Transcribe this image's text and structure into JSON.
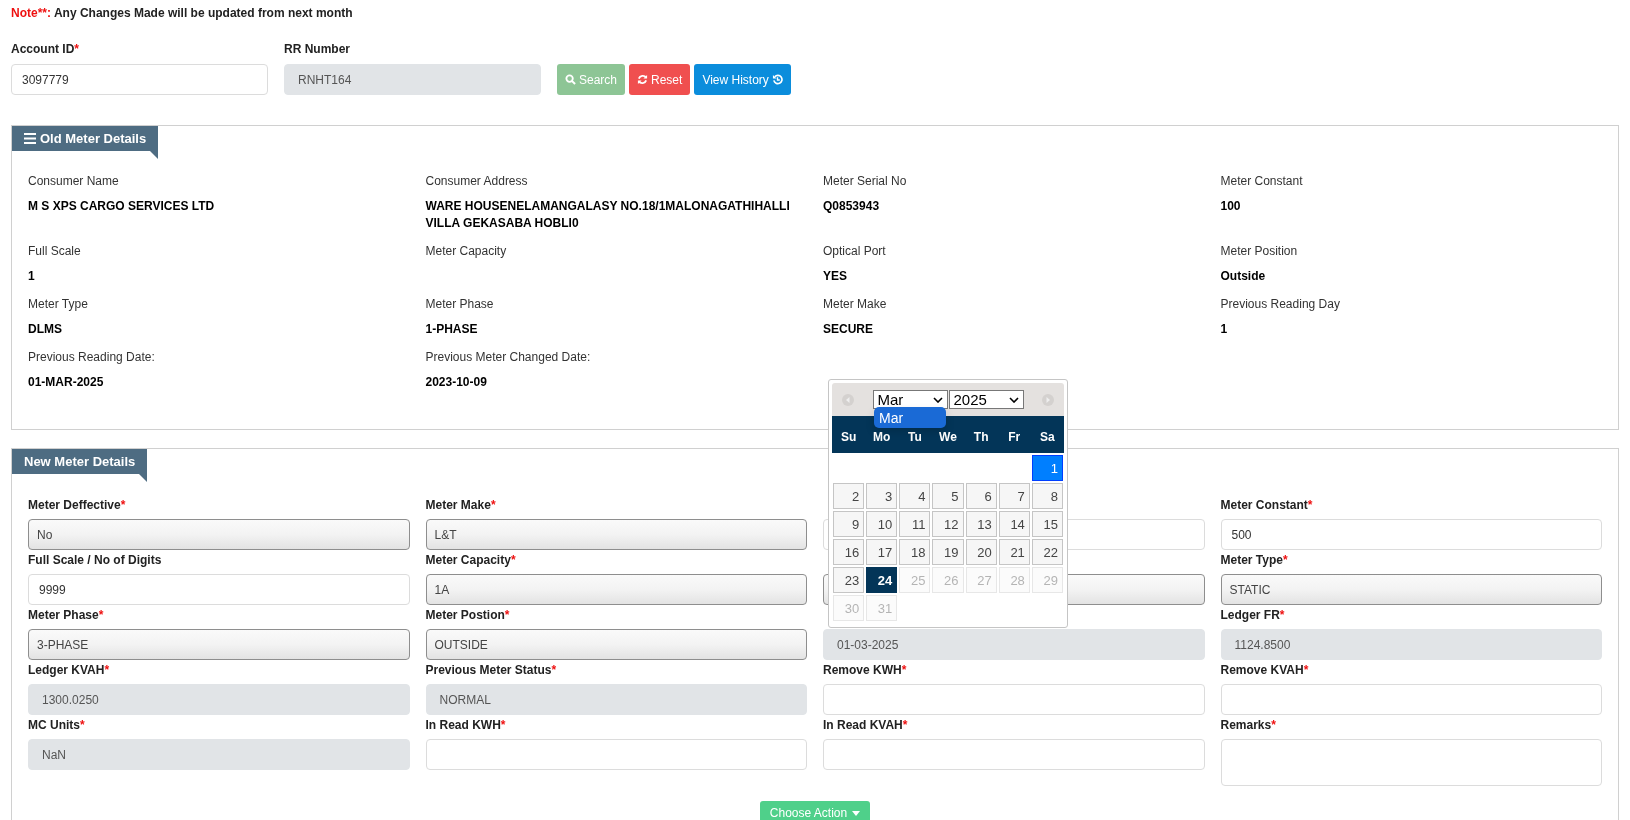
{
  "note": {
    "prefix": "Note**:",
    "text": "Any Changes Made will be updated from next month"
  },
  "search_form": {
    "fields": [
      {
        "label": "Account ID",
        "required_mark": "*",
        "value": "3097779",
        "readonly": false
      },
      {
        "label": "RR Number",
        "value": "RNHT164",
        "readonly": true
      }
    ],
    "buttons": [
      {
        "label": "Search",
        "kind": "search"
      },
      {
        "label": "Reset",
        "kind": "reset"
      },
      {
        "label": "View History",
        "kind": "history"
      }
    ]
  },
  "old_meter": {
    "title": "Old Meter Details",
    "items": [
      {
        "label": "Consumer Name",
        "value": "M S XPS CARGO SERVICES LTD"
      },
      {
        "label": "Consumer Address",
        "value": "WARE HOUSENELAMANGALASY NO.18/1MALONAGATHIHALLI VILLA GEKASABA HOBLI0"
      },
      {
        "label": "Meter Serial No",
        "value": "Q0853943"
      },
      {
        "label": "Meter Constant",
        "value": "100"
      },
      {
        "label": "Full Scale",
        "value": "1"
      },
      {
        "label": "Meter Capacity"
      },
      {
        "label": "Optical Port",
        "value": "YES"
      },
      {
        "label": "Meter Position",
        "value": "Outside"
      },
      {
        "label": "Meter Type",
        "value": "DLMS"
      },
      {
        "label": "Meter Phase",
        "value": "1-PHASE"
      },
      {
        "label": "Meter Make",
        "value": "SECURE"
      },
      {
        "label": "Previous Reading Day",
        "value": "1"
      },
      {
        "label": "Previous Reading Date:",
        "value": "01-MAR-2025"
      },
      {
        "label": "Previous Meter Changed Date:",
        "value": "2023-10-09"
      }
    ]
  },
  "new_meter": {
    "title": "New Meter Details",
    "fields": [
      {
        "label": "Meter Deffective",
        "required_mark": "*",
        "kind": "select",
        "value": "No"
      },
      {
        "label": "Meter Make",
        "required_mark": "*",
        "kind": "select",
        "value": "L&T"
      },
      {
        "kind": "input"
      },
      {
        "label": "Meter Constant",
        "required_mark": "*",
        "kind": "input",
        "value": "500"
      },
      {
        "label": "Full Scale / No of Digits",
        "kind": "input",
        "value": "9999"
      },
      {
        "label": "Meter Capacity",
        "required_mark": "*",
        "kind": "select",
        "value": "1A"
      },
      {
        "kind": "select"
      },
      {
        "label": "Meter Type",
        "required_mark": "*",
        "kind": "select",
        "value": "STATIC"
      },
      {
        "label": "Meter Phase",
        "required_mark": "*",
        "kind": "select",
        "value": "3-PHASE"
      },
      {
        "label": "Meter Postion",
        "required_mark": "*",
        "kind": "select",
        "value": "OUTSIDE"
      },
      {
        "kind": "readonly",
        "value": "01-03-2025"
      },
      {
        "label": "Ledger FR",
        "required_mark": "*",
        "kind": "readonly",
        "value": "1124.8500"
      },
      {
        "label": "Ledger KVAH",
        "required_mark": "*",
        "kind": "readonly",
        "value": "1300.0250"
      },
      {
        "label": "Previous Meter Status",
        "required_mark": "*",
        "kind": "readonly",
        "value": "NORMAL"
      },
      {
        "label": "Remove KWH",
        "required_mark": "*",
        "kind": "input"
      },
      {
        "label": "Remove KVAH",
        "required_mark": "*",
        "kind": "input"
      },
      {
        "label": "MC Units",
        "required_mark": "*",
        "kind": "readonly",
        "value": "NaN"
      },
      {
        "label": "In Read KWH",
        "required_mark": "*",
        "kind": "input"
      },
      {
        "label": "In Read KVAH",
        "required_mark": "*",
        "kind": "input"
      },
      {
        "label": "Remarks",
        "required_mark": "*",
        "kind": "textarea"
      }
    ],
    "action_button": "Choose Action"
  },
  "datepicker": {
    "month": "Mar",
    "year": "2025",
    "month_options": [
      {
        "label": "Mar",
        "selected": true
      }
    ],
    "weekdays": [
      "Su",
      "Mo",
      "Tu",
      "We",
      "Th",
      "Fr",
      "Sa"
    ],
    "weeks": [
      [
        {
          "day": "1",
          "selected": true,
          "today": false,
          "disabled": false
        }
      ],
      [
        {
          "day": "2",
          "selected": false,
          "today": false,
          "disabled": false
        },
        {
          "day": "3",
          "selected": false,
          "today": false,
          "disabled": false
        },
        {
          "day": "4",
          "selected": false,
          "today": false,
          "disabled": false
        },
        {
          "day": "5",
          "selected": false,
          "today": false,
          "disabled": false
        },
        {
          "day": "6",
          "selected": false,
          "today": false,
          "disabled": false
        },
        {
          "day": "7",
          "selected": false,
          "today": false,
          "disabled": false
        },
        {
          "day": "8",
          "selected": false,
          "today": false,
          "disabled": false
        }
      ],
      [
        {
          "day": "9",
          "selected": false,
          "today": false,
          "disabled": false
        },
        {
          "day": "10",
          "selected": false,
          "today": false,
          "disabled": false
        },
        {
          "day": "11",
          "selected": false,
          "today": false,
          "disabled": false
        },
        {
          "day": "12",
          "selected": false,
          "today": false,
          "disabled": false
        },
        {
          "day": "13",
          "selected": false,
          "today": false,
          "disabled": false
        },
        {
          "day": "14",
          "selected": false,
          "today": false,
          "disabled": false
        },
        {
          "day": "15",
          "selected": false,
          "today": false,
          "disabled": false
        }
      ],
      [
        {
          "day": "16",
          "selected": false,
          "today": false,
          "disabled": false
        },
        {
          "day": "17",
          "selected": false,
          "today": false,
          "disabled": false
        },
        {
          "day": "18",
          "selected": false,
          "today": false,
          "disabled": false
        },
        {
          "day": "19",
          "selected": false,
          "today": false,
          "disabled": false
        },
        {
          "day": "20",
          "selected": false,
          "today": false,
          "disabled": false
        },
        {
          "day": "21",
          "selected": false,
          "today": false,
          "disabled": false
        },
        {
          "day": "22",
          "selected": false,
          "today": false,
          "disabled": false
        }
      ],
      [
        {
          "day": "23",
          "selected": false,
          "today": false,
          "disabled": false
        },
        {
          "day": "24",
          "selected": false,
          "today": true,
          "disabled": false
        },
        {
          "day": "25",
          "selected": false,
          "today": false,
          "disabled": true
        },
        {
          "day": "26",
          "selected": false,
          "today": false,
          "disabled": true
        },
        {
          "day": "27",
          "selected": false,
          "today": false,
          "disabled": true
        },
        {
          "day": "28",
          "selected": false,
          "today": false,
          "disabled": true
        },
        {
          "day": "29",
          "selected": false,
          "today": false,
          "disabled": true
        }
      ],
      [
        {
          "day": "30",
          "selected": false,
          "today": false,
          "disabled": true
        },
        {
          "day": "31",
          "selected": false,
          "today": false,
          "disabled": true
        }
      ]
    ]
  }
}
